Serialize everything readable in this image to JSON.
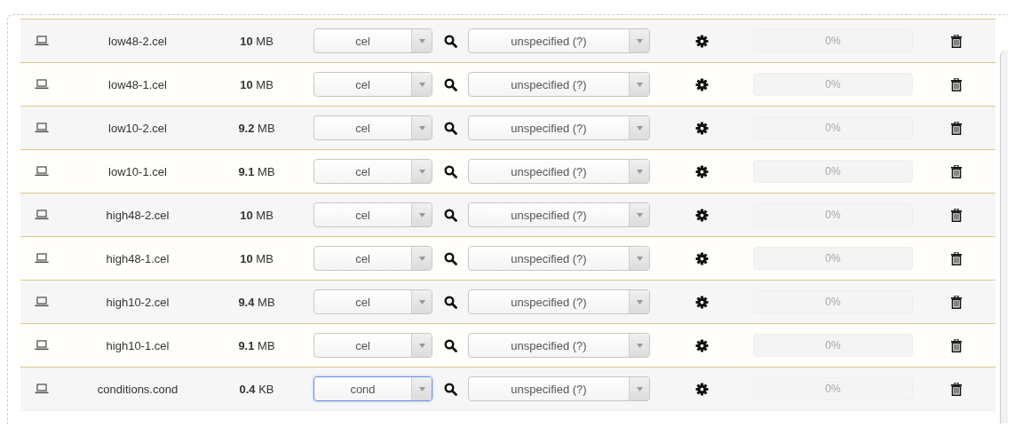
{
  "files": [
    {
      "name": "low48-2.cel",
      "size_value": "10",
      "size_unit": "MB",
      "type": "cel",
      "focused": false,
      "annotation": "unspecified (?)",
      "progress_text": "0%",
      "level": 0
    },
    {
      "name": "low48-1.cel",
      "size_value": "10",
      "size_unit": "MB",
      "type": "cel",
      "focused": false,
      "annotation": "unspecified (?)",
      "progress_text": "0%",
      "level": 0
    },
    {
      "name": "low10-2.cel",
      "size_value": "9.2",
      "size_unit": "MB",
      "type": "cel",
      "focused": false,
      "annotation": "unspecified (?)",
      "progress_text": "0%",
      "level": 0
    },
    {
      "name": "low10-1.cel",
      "size_value": "9.1",
      "size_unit": "MB",
      "type": "cel",
      "focused": false,
      "annotation": "unspecified (?)",
      "progress_text": "0%",
      "level": 0
    },
    {
      "name": "high48-2.cel",
      "size_value": "10",
      "size_unit": "MB",
      "type": "cel",
      "focused": false,
      "annotation": "unspecified (?)",
      "progress_text": "0%",
      "level": 0
    },
    {
      "name": "high48-1.cel",
      "size_value": "10",
      "size_unit": "MB",
      "type": "cel",
      "focused": false,
      "annotation": "unspecified (?)",
      "progress_text": "0%",
      "level": 0
    },
    {
      "name": "high10-2.cel",
      "size_value": "9.4",
      "size_unit": "MB",
      "type": "cel",
      "focused": false,
      "annotation": "unspecified (?)",
      "progress_text": "0%",
      "level": 0
    },
    {
      "name": "high10-1.cel",
      "size_value": "9.1",
      "size_unit": "MB",
      "type": "cel",
      "focused": false,
      "annotation": "unspecified (?)",
      "progress_text": "0%",
      "level": 0
    },
    {
      "name": "conditions.cond",
      "size_value": "0.4",
      "size_unit": "KB",
      "type": "cond",
      "focused": true,
      "annotation": "unspecified (?)",
      "progress_text": "0%",
      "level": 0
    }
  ]
}
